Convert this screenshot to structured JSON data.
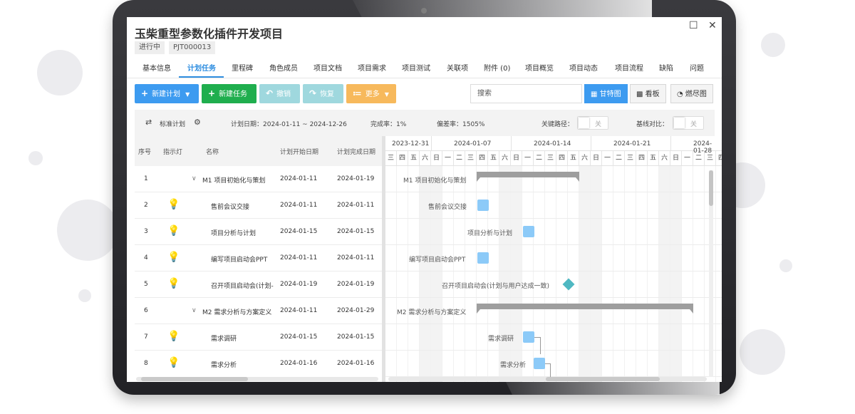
{
  "app": {
    "title": "玉柴重型参数化插件开发项目",
    "status_tag": "进行中",
    "code_tag": "PJT000013",
    "window_buttons": {
      "maximize": "☐",
      "close": "✕"
    }
  },
  "tabs": [
    {
      "label": "基本信息"
    },
    {
      "label": "计划任务",
      "active": true
    },
    {
      "label": "里程碑"
    },
    {
      "label": "角色成员"
    },
    {
      "label": "项目文档"
    },
    {
      "label": "项目需求"
    },
    {
      "label": "项目测试"
    },
    {
      "label": "关联项"
    },
    {
      "label": "附件 (0)"
    },
    {
      "label": "项目概览"
    },
    {
      "label": "项目动态"
    },
    {
      "label": "项目流程"
    },
    {
      "label": "缺陷"
    },
    {
      "label": "问题"
    }
  ],
  "toolbar": {
    "new_plan": {
      "label": "新建计划",
      "icon": "+",
      "color": "#3d9bf0"
    },
    "new_task": {
      "label": "新建任务",
      "icon": "+",
      "color": "#1fae4e"
    },
    "undo": {
      "label": "撤销",
      "icon": "↶",
      "color": "#9fd8de"
    },
    "redo": {
      "label": "恢复",
      "icon": "↷",
      "color": "#9fd8de"
    },
    "more": {
      "label": "更多",
      "icon": "≔",
      "color": "#f7b95c"
    },
    "search_placeholder": "搜索",
    "views": {
      "gantt": "甘特图",
      "board": "看板",
      "burndown": "燃尽图"
    }
  },
  "infobar": {
    "plan_mode": "标准计划",
    "plan_dates": "计划日期：2024-01-11 ~ 2024-12-26",
    "completion": "完成率：1%",
    "deviation": "偏差率：1505%",
    "critical_path_label": "关键路径：",
    "critical_path_state": "关",
    "baseline_label": "基线对比：",
    "baseline_state": "关"
  },
  "columns": [
    "序号",
    "指示灯",
    "名称",
    "计划开始日期",
    "计划完成日期"
  ],
  "rows": [
    {
      "no": "1",
      "name": "M1 项目初始化与策划",
      "start": "2024-01-11",
      "end": "2024-01-19",
      "group": true
    },
    {
      "no": "2",
      "name": "售前会议交接",
      "start": "2024-01-11",
      "end": "2024-01-11",
      "light": true
    },
    {
      "no": "3",
      "name": "项目分析与计划",
      "start": "2024-01-15",
      "end": "2024-01-15",
      "light": true
    },
    {
      "no": "4",
      "name": "编写项目启动会PPT",
      "start": "2024-01-11",
      "end": "2024-01-11",
      "light": true
    },
    {
      "no": "5",
      "name": "召开项目启动会(计划-",
      "start": "2024-01-19",
      "end": "2024-01-19",
      "light": true
    },
    {
      "no": "6",
      "name": "M2 需求分析与方案定义",
      "start": "2024-01-11",
      "end": "2024-01-29",
      "group": true
    },
    {
      "no": "7",
      "name": "需求调研",
      "start": "2024-01-15",
      "end": "2024-01-15",
      "light": true
    },
    {
      "no": "8",
      "name": "需求分析",
      "start": "2024-01-16",
      "end": "2024-01-16",
      "light": true
    }
  ],
  "gantt": {
    "week_labels": [
      "2023-12-31",
      "2024-01-07",
      "2024-01-14",
      "2024-01-21",
      "2024-01-28"
    ],
    "weekdays": [
      "三",
      "四",
      "五",
      "六",
      "日",
      "一",
      "二",
      "三",
      "四",
      "五",
      "六",
      "日",
      "一",
      "二",
      "三",
      "四",
      "五",
      "六",
      "日",
      "一",
      "二",
      "三",
      "四",
      "五",
      "六",
      "日",
      "一",
      "二",
      "三",
      "四",
      "五",
      "六",
      "日",
      "一"
    ],
    "bar_labels": [
      "M1 项目初始化与策划",
      "售前会议交接",
      "项目分析与计划",
      "编写项目启动会PPT",
      "召开项目启动会(计划与用户达成一致)",
      "M2 需求分析与方案定义",
      "需求调研",
      "需求分析"
    ]
  }
}
